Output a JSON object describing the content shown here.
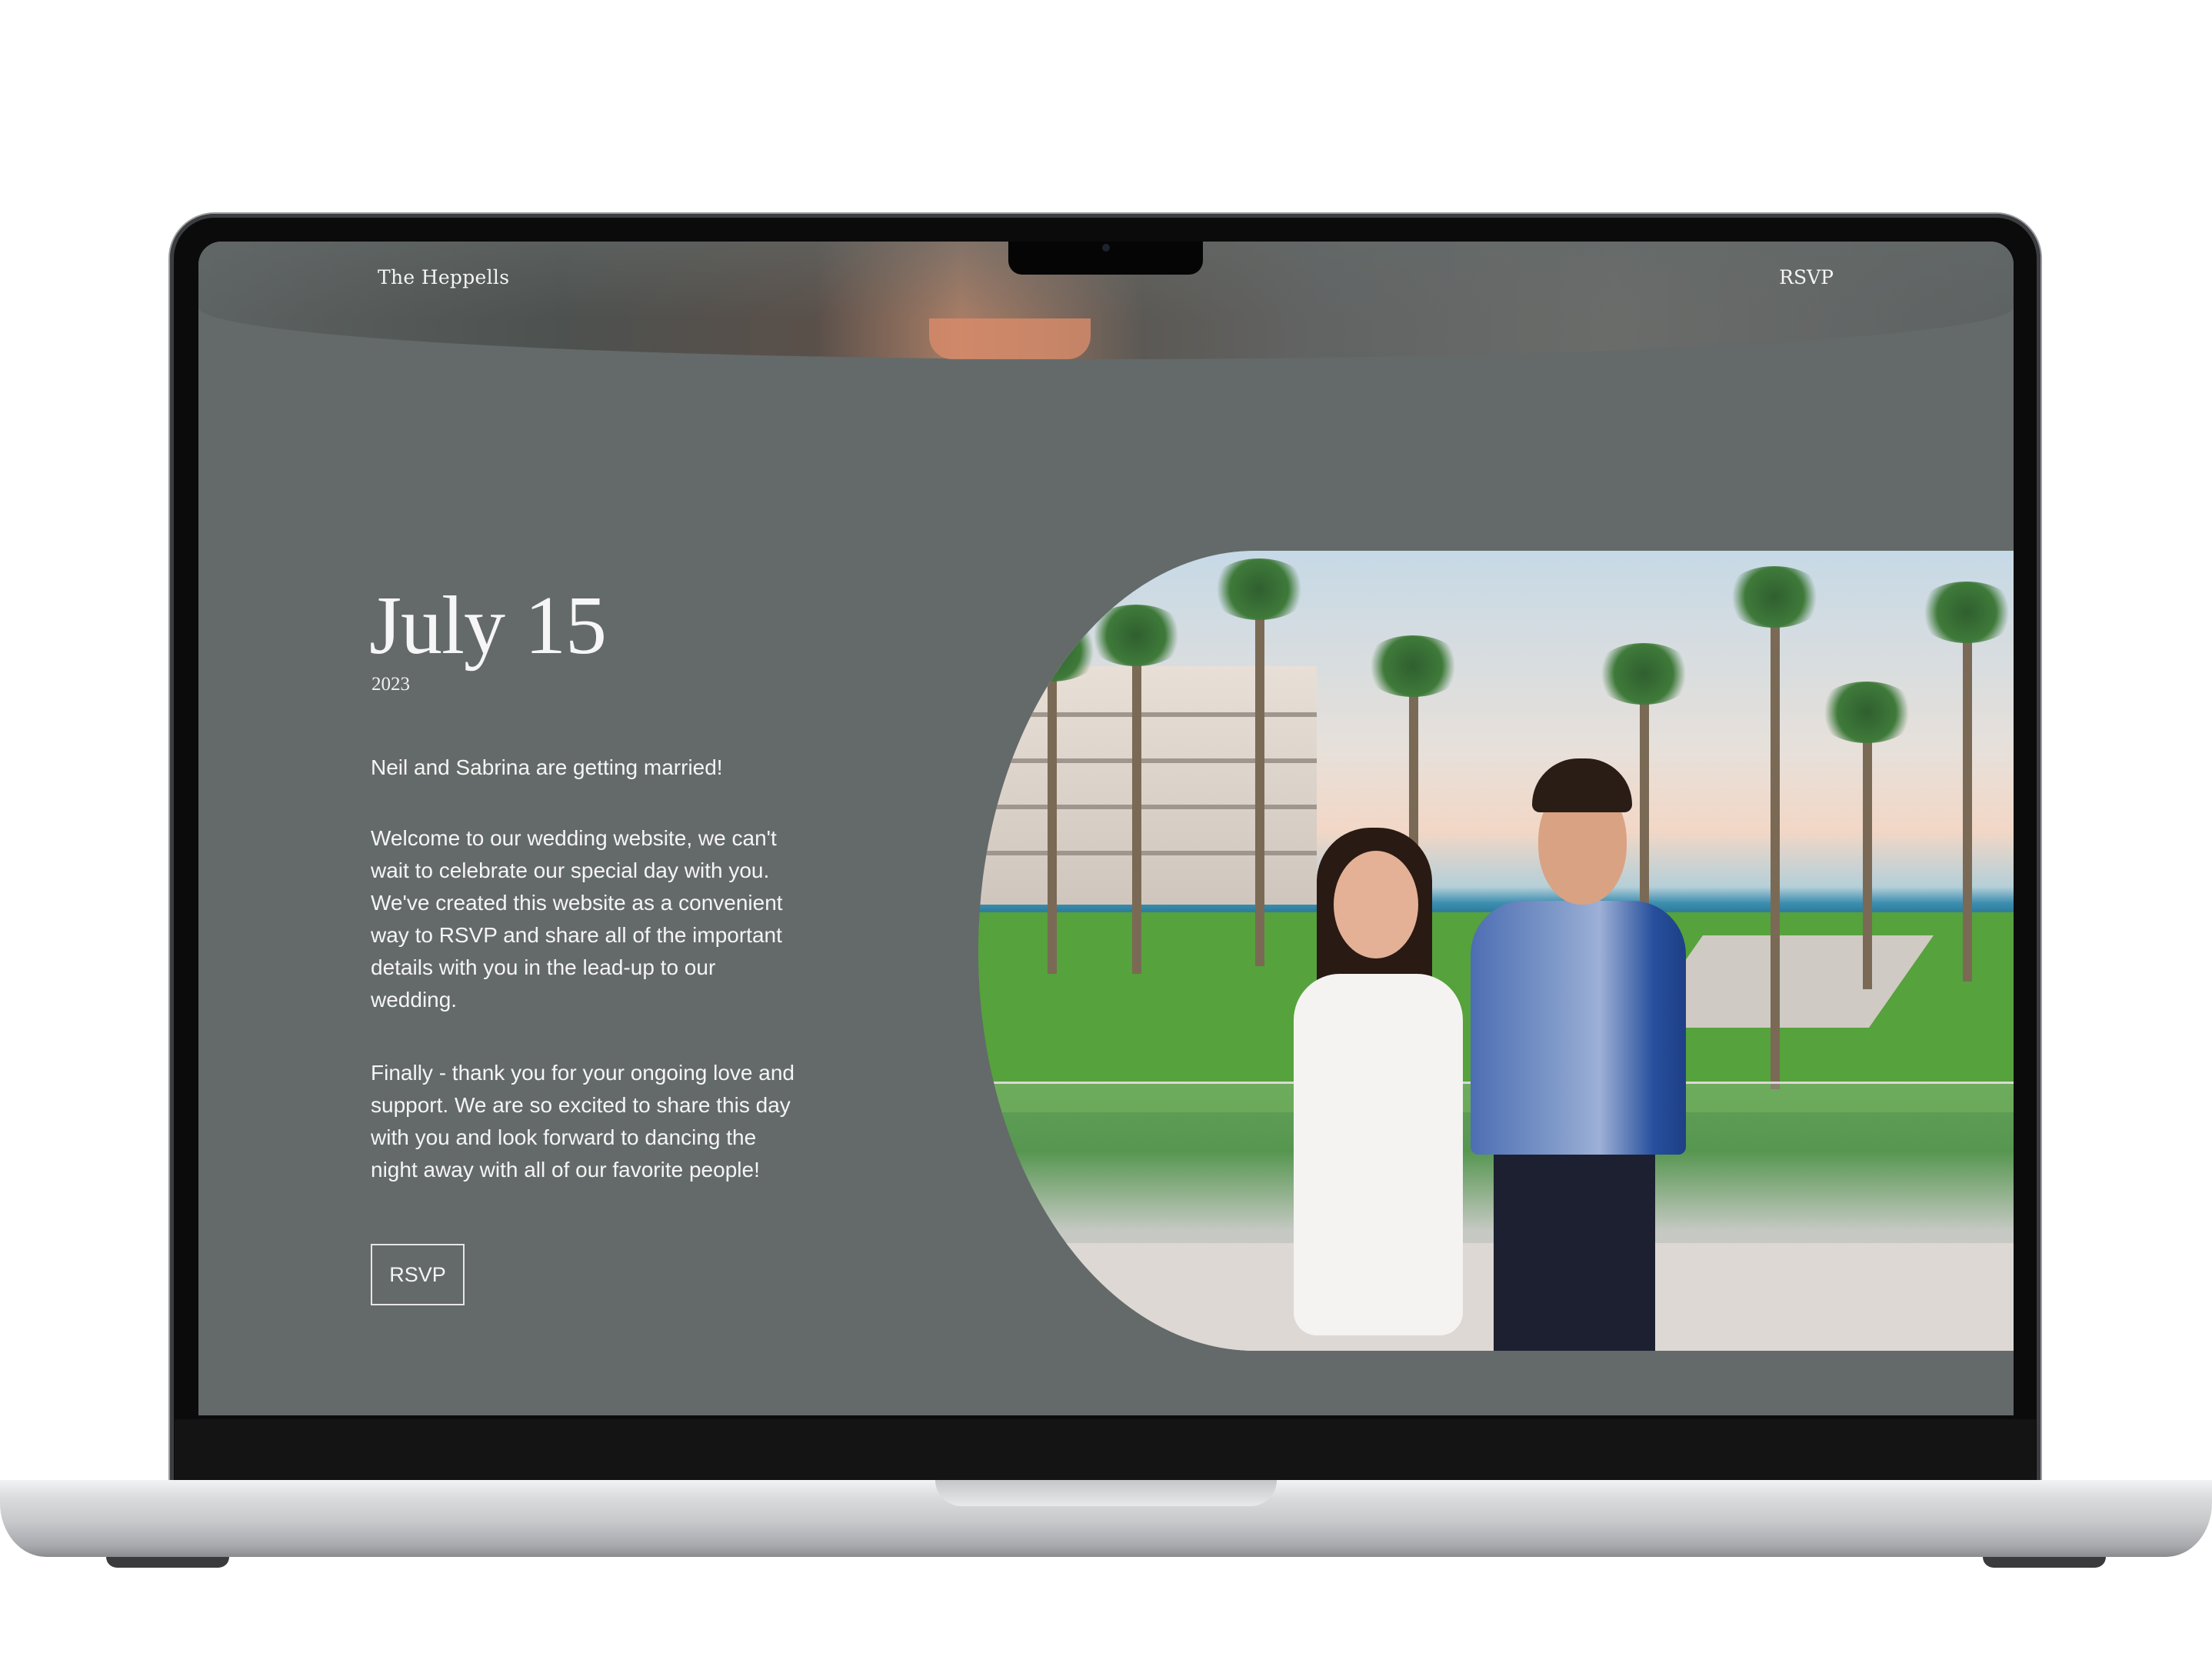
{
  "nav": {
    "brand": "The Heppells",
    "rsvp_label": "RSVP"
  },
  "hero": {
    "date": "July 15",
    "year": "2023"
  },
  "content": {
    "intro": "Neil and Sabrina are getting married!",
    "welcome": "Welcome to our wedding website, we can't wait to celebrate our special day with you. We've created this website as a convenient way to RSVP and share all of the important details with you in the lead-up to our wedding.",
    "closing": "Finally - thank you for your ongoing love and support. We are so excited to share this day with you and look forward to dancing the night away with all of our favorite people!",
    "rsvp_button": "RSVP"
  },
  "colors": {
    "page_background": "#646a69",
    "text": "#f5f5f5"
  }
}
